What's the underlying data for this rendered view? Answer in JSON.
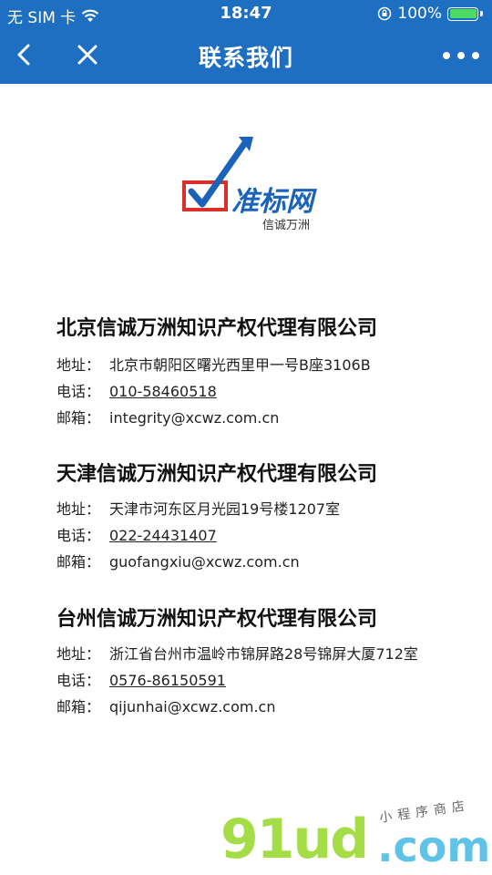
{
  "status_bar": {
    "carrier": "无 SIM 卡",
    "time": "18:47",
    "battery_percent": "100%",
    "battery_level": 1.0,
    "battery_color": "#4cd964"
  },
  "nav": {
    "title": "联系我们",
    "back_icon": "chevron-left-icon",
    "close_icon": "close-icon",
    "more_icon": "more-dots-icon",
    "background_color": "#1e6fc2"
  },
  "logo": {
    "name": "准标网",
    "slogan": "信诚万洲"
  },
  "companies": [
    {
      "name": "北京信诚万洲知识产权代理有限公司",
      "address_label": "地址：",
      "address": "北京市朝阳区曙光西里甲一号B座3106B",
      "phone_label": "电话：",
      "phone": "010-58460518",
      "email_label": "邮箱：",
      "email": "integrity@xcwz.com.cn"
    },
    {
      "name": "天津信诚万洲知识产权代理有限公司",
      "address_label": "地址：",
      "address": "天津市河东区月光园19号楼1207室",
      "phone_label": "电话：",
      "phone": "022-24431407",
      "email_label": "邮箱：",
      "email": "guofangxiu@xcwz.com.cn"
    },
    {
      "name": "台州信诚万洲知识产权代理有限公司",
      "address_label": "地址：",
      "address": "浙江省台州市温岭市锦屏路28号锦屏大厦712室",
      "phone_label": "电话：",
      "phone": "0576-86150591",
      "email_label": "邮箱：",
      "email": "qijunhai@xcwz.com.cn"
    }
  ],
  "watermark": {
    "main": "91ud",
    "domain": ".com",
    "tagline": "小程序商店"
  }
}
